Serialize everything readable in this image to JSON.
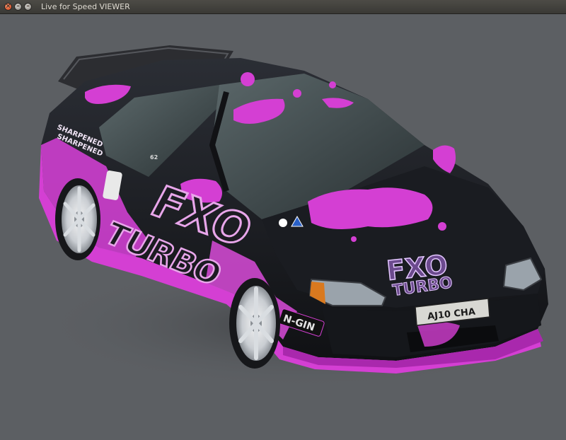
{
  "window": {
    "title": "Live for Speed VIEWER",
    "buttons": {
      "close": "×",
      "minimize": "–",
      "maximize": "–"
    }
  },
  "livery": {
    "side_text_1": "FXO",
    "side_text_2": "TURBO",
    "hood_text_1": "FXO",
    "hood_text_2": "TURBO",
    "license_plate": "AJ10 CHA",
    "skirt_badge": "N-GIN",
    "window_sticker": "SHARPENED",
    "roof_number": "62"
  },
  "colors": {
    "background": "#5c5f63",
    "body": "#1b1d22",
    "paint_splash": "#d43fd3",
    "accent_magenta": "#e156e6"
  }
}
